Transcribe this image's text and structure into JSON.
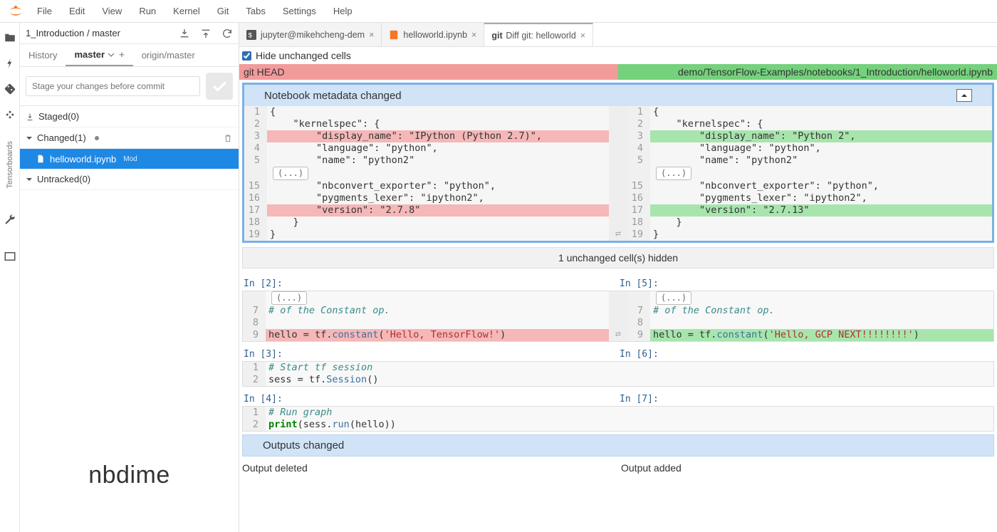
{
  "menu": {
    "items": [
      "File",
      "Edit",
      "View",
      "Run",
      "Kernel",
      "Git",
      "Tabs",
      "Settings",
      "Help"
    ]
  },
  "sidebar": {
    "path": "1_Introduction / master",
    "branch_tabs": {
      "history": "History",
      "current": "master",
      "remote": "origin/master"
    },
    "commit_placeholder": "Stage your changes before commit",
    "staged": "Staged(0)",
    "changed": "Changed(1)",
    "file": "helloworld.ipynb",
    "file_badge": "Mod",
    "untracked": "Untracked(0)"
  },
  "rail": {
    "tensorboards": "Tensorboards"
  },
  "watermark": "nbdime",
  "tabs": [
    {
      "label": "jupyter@mikehcheng-dem",
      "active": false,
      "icon": "terminal"
    },
    {
      "label": "helloworld.ipynb",
      "active": false,
      "icon": "notebook"
    },
    {
      "label": "Diff git: helloworld",
      "active": true,
      "icon": "git"
    }
  ],
  "diff": {
    "hide_label": "Hide unchanged cells",
    "left_header": "git HEAD",
    "right_header": "demo/TensorFlow-Examples/notebooks/1_Introduction/helloworld.ipynb",
    "metadata_title": "Notebook metadata changed",
    "hidden_banner": "1 unchanged cell(s) hidden",
    "left_lines": [
      {
        "n": "1",
        "t": "{"
      },
      {
        "n": "2",
        "t": "    \"kernelspec\": {"
      },
      {
        "n": "3",
        "t": "        \"display_name\": \"IPython (Python 2.7)\",",
        "cls": "rm"
      },
      {
        "n": "4",
        "t": "        \"language\": \"python\","
      },
      {
        "n": "5",
        "t": "        \"name\": \"python2\""
      },
      {
        "n": "",
        "t": "(...)",
        "el": true
      },
      {
        "n": "15",
        "t": "        \"nbconvert_exporter\": \"python\","
      },
      {
        "n": "16",
        "t": "        \"pygments_lexer\": \"ipython2\","
      },
      {
        "n": "17",
        "t": "        \"version\": \"2.7.8\"",
        "cls": "rm"
      },
      {
        "n": "18",
        "t": "    }"
      },
      {
        "n": "19",
        "t": "}"
      }
    ],
    "right_lines": [
      {
        "n": "1",
        "t": "{"
      },
      {
        "n": "2",
        "t": "    \"kernelspec\": {"
      },
      {
        "n": "3",
        "t": "        \"display_name\": \"Python 2\",",
        "cls": "add"
      },
      {
        "n": "4",
        "t": "        \"language\": \"python\","
      },
      {
        "n": "5",
        "t": "        \"name\": \"python2\""
      },
      {
        "n": "",
        "t": "(...)",
        "el": true
      },
      {
        "n": "15",
        "t": "        \"nbconvert_exporter\": \"python\","
      },
      {
        "n": "16",
        "t": "        \"pygments_lexer\": \"ipython2\","
      },
      {
        "n": "17",
        "t": "        \"version\": \"2.7.13\"",
        "cls": "add"
      },
      {
        "n": "18",
        "t": "    }"
      },
      {
        "n": "19",
        "t": "}"
      }
    ],
    "cell2": {
      "left_in": "In [2]:",
      "right_in": "In [5]:",
      "left": [
        {
          "n": "",
          "t": "(...)",
          "el": true
        },
        {
          "n": "7",
          "t": "# of the Constant op.",
          "cm": true
        },
        {
          "n": "8",
          "t": ""
        },
        {
          "n": "9",
          "t": "hello = tf.constant('Hello, TensorFlow!')",
          "cls": "rm",
          "hl": true
        }
      ],
      "right": [
        {
          "n": "",
          "t": "(...)",
          "el": true
        },
        {
          "n": "7",
          "t": "# of the Constant op.",
          "cm": true
        },
        {
          "n": "8",
          "t": ""
        },
        {
          "n": "9",
          "t": "hello = tf.constant('Hello, GCP NEXT!!!!!!!!')",
          "cls": "add",
          "hl": true
        }
      ]
    },
    "cell3": {
      "left_in": "In [3]:",
      "right_in": "In [6]:",
      "lines": [
        {
          "n": "1",
          "t": "# Start tf session",
          "cm": true
        },
        {
          "n": "2",
          "t": "sess = tf.Session()",
          "sess": true
        }
      ]
    },
    "cell4": {
      "left_in": "In [4]:",
      "right_in": "In [7]:",
      "lines": [
        {
          "n": "1",
          "t": "# Run graph",
          "cm": true
        },
        {
          "n": "2",
          "t": "print(sess.run(hello))",
          "pr": true
        }
      ]
    },
    "outputs_title": "Outputs changed",
    "out_deleted": "Output deleted",
    "out_added": "Output added"
  }
}
